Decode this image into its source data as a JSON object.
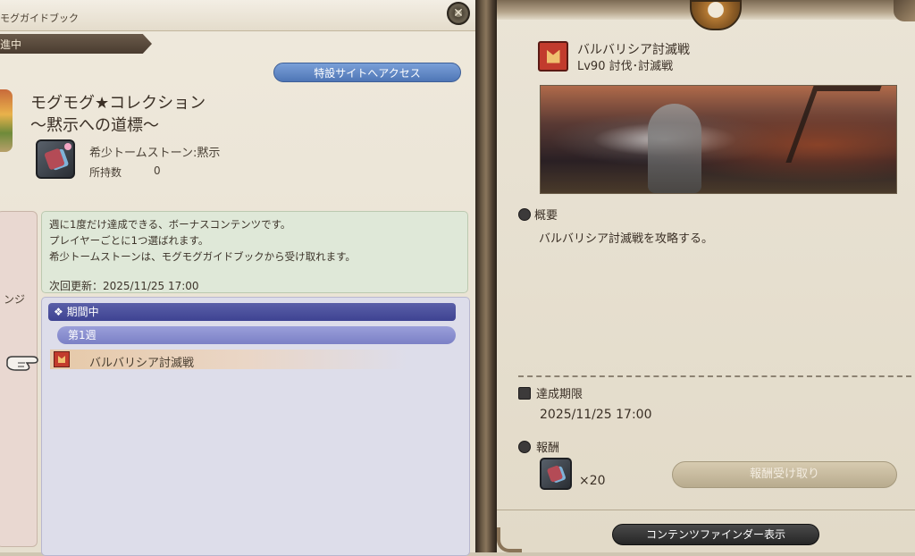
{
  "left_panel": {
    "window_title": "モグガイドブック",
    "status_tab": "進中",
    "site_button": "特設サイトへアクセス",
    "collection_title_1": "モグモグ★コレクション",
    "collection_title_2": "～黙示への道標～",
    "tomestone_name": "希少トームストーン:黙示",
    "owned_label": "所持数",
    "owned_value": "0",
    "side_tab_label": "ンジ",
    "info_lines": [
      "週に1度だけ達成できる、ボーナスコンテンツです。",
      "プレイヤーごとに1つ選ばれます。",
      "希少トームストーンは、モグモグガイドブックから受け取れます。"
    ],
    "next_update": "次回更新：2025/11/25 17:00",
    "period_header": "❖ 期間中",
    "week_header": "第1週",
    "duty_item": "バルバリシア討滅戦"
  },
  "right_panel": {
    "duty_name": "バルバリシア討滅戦",
    "duty_level": "Lv90 討伐･討滅戦",
    "overview_label": "概要",
    "overview_text": "バルバリシア討滅戦を攻略する。",
    "deadline_label": "達成期限",
    "deadline_value": "2025/11/25 17:00",
    "reward_label": "報酬",
    "reward_count": "×20",
    "receive_button": "報酬受け取り",
    "finder_button": "コンテンツファインダー表示"
  },
  "icons": {
    "close": "close-ornament-icon",
    "tomestone": "tomestone-icon",
    "duty": "trial-duty-icon",
    "pointer": "hand-pointer-icon",
    "book": "book-icon",
    "calendar": "calendar-icon",
    "reward": "reward-icon"
  },
  "colors": {
    "period_header": "#3e4392",
    "week_header": "#7b80c6",
    "site_button": "#4f76b6",
    "info_box": "#dfe8d8",
    "list_panel": "#ddddea"
  }
}
